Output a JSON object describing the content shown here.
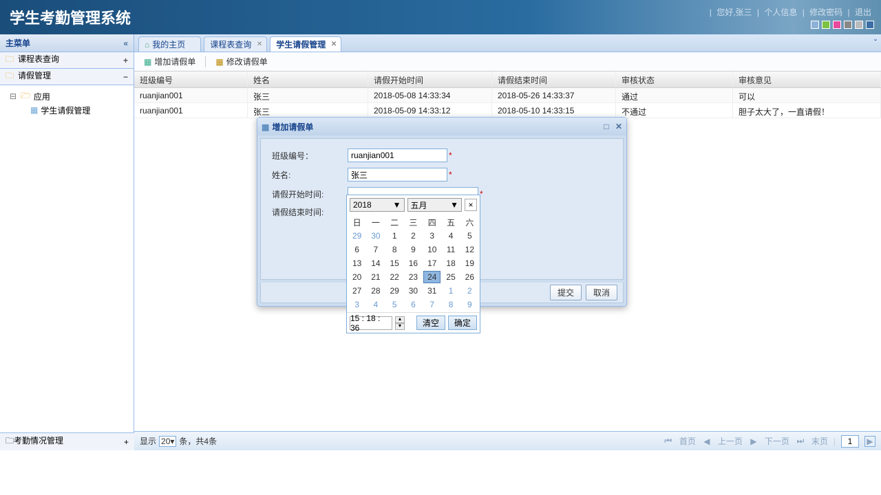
{
  "header": {
    "title": "学生考勤管理系统",
    "greeting": "您好,张三",
    "links": {
      "profile": "个人信息",
      "password": "修改密码",
      "logout": "退出"
    }
  },
  "sidebar": {
    "main_title": "主菜单",
    "sections": {
      "schedule": "课程表查询",
      "leave": "请假管理",
      "attendance": "考勤情况管理"
    },
    "tree": {
      "app": "应用",
      "leave_mgmt": "学生请假管理"
    }
  },
  "tabs": {
    "home": "我的主页",
    "schedule": "课程表查询",
    "leave": "学生请假管理"
  },
  "toolbar": {
    "add": "增加请假单",
    "edit": "修改请假单"
  },
  "grid": {
    "headers": {
      "class_no": "班级编号",
      "name": "姓名",
      "start": "请假开始时间",
      "end": "请假结束时间",
      "status": "审核状态",
      "opinion": "审核意见"
    },
    "rows": [
      {
        "class_no": "ruanjian001",
        "name": "张三",
        "start": "2018-05-08 14:33:34",
        "end": "2018-05-26 14:33:37",
        "status": "通过",
        "opinion": "可以"
      },
      {
        "class_no": "ruanjian001",
        "name": "张三",
        "start": "2018-05-09 14:33:12",
        "end": "2018-05-10 14:33:15",
        "status": "不通过",
        "opinion": "胆子太大了，一直请假！"
      }
    ]
  },
  "dialog": {
    "title": "增加请假单",
    "labels": {
      "class_no": "班级编号：",
      "name": "姓名:",
      "start": "请假开始时间:",
      "end": "请假结束时间:"
    },
    "values": {
      "class_no": "ruanjian001",
      "name": "张三"
    },
    "buttons": {
      "submit": "提交",
      "cancel": "取消"
    }
  },
  "datepicker": {
    "year": "2018",
    "month": "五月",
    "weekdays": [
      "日",
      "一",
      "二",
      "三",
      "四",
      "五",
      "六"
    ],
    "weeks": [
      [
        {
          "d": "29",
          "o": true
        },
        {
          "d": "30",
          "o": true
        },
        {
          "d": "1"
        },
        {
          "d": "2"
        },
        {
          "d": "3"
        },
        {
          "d": "4"
        },
        {
          "d": "5"
        }
      ],
      [
        {
          "d": "6"
        },
        {
          "d": "7"
        },
        {
          "d": "8"
        },
        {
          "d": "9"
        },
        {
          "d": "10"
        },
        {
          "d": "11"
        },
        {
          "d": "12"
        }
      ],
      [
        {
          "d": "13"
        },
        {
          "d": "14"
        },
        {
          "d": "15"
        },
        {
          "d": "16"
        },
        {
          "d": "17"
        },
        {
          "d": "18"
        },
        {
          "d": "19"
        }
      ],
      [
        {
          "d": "20"
        },
        {
          "d": "21"
        },
        {
          "d": "22"
        },
        {
          "d": "23"
        },
        {
          "d": "24",
          "sel": true
        },
        {
          "d": "25"
        },
        {
          "d": "26"
        }
      ],
      [
        {
          "d": "27"
        },
        {
          "d": "28"
        },
        {
          "d": "29"
        },
        {
          "d": "30"
        },
        {
          "d": "31"
        },
        {
          "d": "1",
          "o": true
        },
        {
          "d": "2",
          "o": true
        }
      ],
      [
        {
          "d": "3",
          "o": true
        },
        {
          "d": "4",
          "o": true
        },
        {
          "d": "5",
          "o": true
        },
        {
          "d": "6",
          "o": true
        },
        {
          "d": "7",
          "o": true
        },
        {
          "d": "8",
          "o": true
        },
        {
          "d": "9",
          "o": true
        }
      ]
    ],
    "time": "15 : 18 : 36",
    "clear": "清空",
    "ok": "确定"
  },
  "pager": {
    "show": "显示",
    "per": "20",
    "unit": "条，共4条",
    "first": "首页",
    "prev": "上一页",
    "next": "下一页",
    "last": "末页",
    "page": "1"
  }
}
